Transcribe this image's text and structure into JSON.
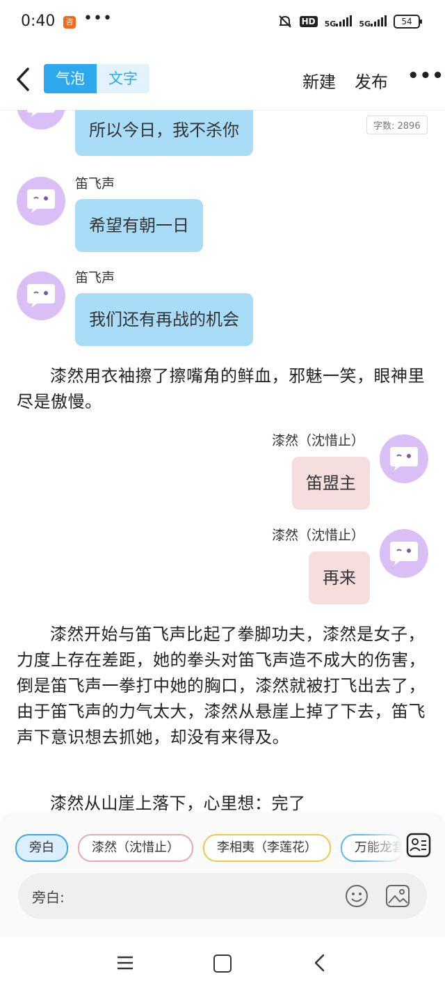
{
  "status_bar": {
    "time": "0:40",
    "app_icon_text": "咨",
    "more": "•••",
    "hd": "HD",
    "signal1": "5G",
    "signal2": "5G",
    "battery": "54"
  },
  "header": {
    "tab_bubble": "气泡",
    "tab_text": "文字",
    "new_label": "新建",
    "publish_label": "发布",
    "more_label": "•••"
  },
  "word_count": "字数: 2896",
  "messages": {
    "m0_text": "所以今日，我不杀你",
    "m1_name": "笛飞声",
    "m1_text": "希望有朝一日",
    "m2_name": "笛飞声",
    "m2_text": "我们还有再战的机会",
    "narr1": "漆然用衣袖擦了擦嘴角的鲜血，邪魅一笑，眼神里尽是傲慢。",
    "m3_name": "漆然（沈惜止）",
    "m3_text": "笛盟主",
    "m4_name": "漆然（沈惜止）",
    "m4_text": "再来",
    "narr2": "漆然开始与笛飞声比起了拳脚功夫，漆然是女子，力度上存在差距，她的拳头对笛飞声造不成大的伤害，倒是笛飞声一拳打中她的胸口，漆然就被打飞出去了，由于笛飞声的力气太大，漆然从悬崖上掉了下去，笛飞声下意识想去抓她，却没有来得及。",
    "narr3": "漆然从山崖上落下，心里想：完了"
  },
  "roles": {
    "r0": "旁白",
    "r1": "漆然（沈惜止）",
    "r2": "李相夷（李莲花）",
    "r3": "万能龙套"
  },
  "input": {
    "label": "旁白:"
  },
  "colors": {
    "accent": "#2ea8ec",
    "left_bubble": "#a9dcf7",
    "right_bubble": "#f6dede",
    "avatar": "#d9bff5"
  }
}
